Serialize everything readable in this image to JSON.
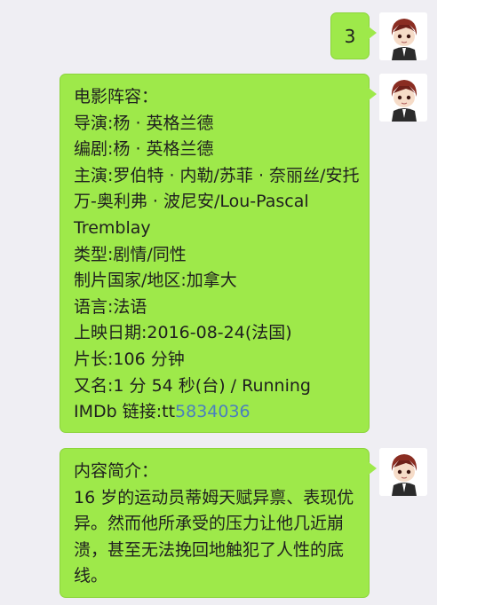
{
  "messages": [
    {
      "text": "3"
    },
    {
      "lines": [
        "电影阵容：",
        "导演:杨 · 英格兰德",
        "编剧:杨 · 英格兰德",
        "主演:罗伯特 · 内勒/苏菲 · 奈丽丝/安托万-奥利弗 · 波尼安/Lou-Pascal Tremblay",
        "类型:剧情/同性",
        "制片国家/地区:加拿大",
        "语言:法语",
        "上映日期:2016-08-24(法国)",
        "片长:106 分钟",
        "又名:1 分 54 秒(台) / Running"
      ],
      "imdb_prefix": "IMDb 链接:tt",
      "imdb_id": "5834036"
    },
    {
      "heading": "内容简介：",
      "body": "16 岁的运动员蒂姆天赋异禀、表现优异。然而他所承受的压力让他几近崩溃，甚至无法挽回地触犯了人性的底线。"
    }
  ],
  "colors": {
    "bubble": "#9ee94a",
    "link": "#4a7fbf",
    "background": "#efeef3"
  },
  "icons": [
    "avatar-icon"
  ]
}
